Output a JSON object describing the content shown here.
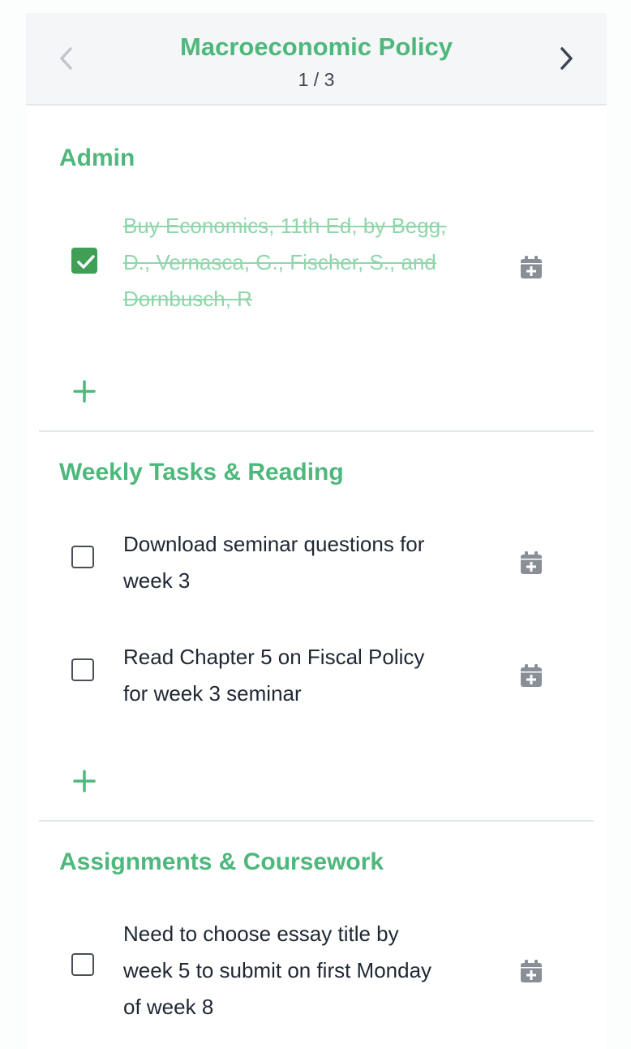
{
  "header": {
    "title": "Macroeconomic Policy",
    "page_indicator": "1 / 3",
    "prev_icon": "chevron-left-icon",
    "next_icon": "chevron-right-icon"
  },
  "sections": [
    {
      "title": "Admin",
      "tasks": [
        {
          "text": "Buy Economics, 11th Ed, by Begg, D., Vernasca, G., Fischer, S., and Dornbusch, R",
          "checked": true
        }
      ]
    },
    {
      "title": "Weekly Tasks & Reading",
      "tasks": [
        {
          "text": "Download seminar questions for week 3",
          "checked": false
        },
        {
          "text": "Read Chapter 5 on Fiscal Policy for week 3 seminar",
          "checked": false
        }
      ]
    },
    {
      "title": "Assignments & Coursework",
      "tasks": [
        {
          "text": "Need to choose essay title by week 5 to submit on first Monday of week 8",
          "checked": false
        }
      ]
    }
  ],
  "icons": {
    "calendar": "calendar-plus-icon",
    "add": "plus-icon",
    "check": "checkmark-icon"
  },
  "colors": {
    "accent": "#4eb87c",
    "checked": "#3f9f55",
    "done_text": "#8fd6ab",
    "text": "#1f2733",
    "icon_gray": "#8a8f97",
    "header_bg": "#f5f6f8"
  }
}
